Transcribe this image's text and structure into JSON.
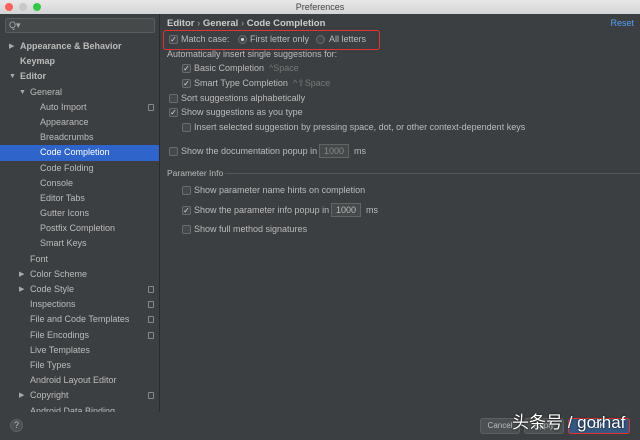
{
  "window": {
    "title": "Preferences"
  },
  "search": {
    "placeholder": "Q▾"
  },
  "sidebar": {
    "items": [
      {
        "label": "Appearance & Behavior",
        "level": 0,
        "arrow": "▶",
        "bold": true
      },
      {
        "label": "Keymap",
        "level": 0,
        "bold": true
      },
      {
        "label": "Editor",
        "level": 0,
        "arrow": "▼",
        "bold": true
      },
      {
        "label": "General",
        "level": 1,
        "arrow": "▼"
      },
      {
        "label": "Auto Import",
        "level": 2,
        "copy": true
      },
      {
        "label": "Appearance",
        "level": 2
      },
      {
        "label": "Breadcrumbs",
        "level": 2
      },
      {
        "label": "Code Completion",
        "level": 2,
        "selected": true
      },
      {
        "label": "Code Folding",
        "level": 2
      },
      {
        "label": "Console",
        "level": 2
      },
      {
        "label": "Editor Tabs",
        "level": 2
      },
      {
        "label": "Gutter Icons",
        "level": 2
      },
      {
        "label": "Postfix Completion",
        "level": 2
      },
      {
        "label": "Smart Keys",
        "level": 2
      },
      {
        "label": "Font",
        "level": 1
      },
      {
        "label": "Color Scheme",
        "level": 1,
        "arrow": "▶"
      },
      {
        "label": "Code Style",
        "level": 1,
        "arrow": "▶",
        "copy": true
      },
      {
        "label": "Inspections",
        "level": 1,
        "copy": true
      },
      {
        "label": "File and Code Templates",
        "level": 1,
        "copy": true
      },
      {
        "label": "File Encodings",
        "level": 1,
        "copy": true
      },
      {
        "label": "Live Templates",
        "level": 1
      },
      {
        "label": "File Types",
        "level": 1
      },
      {
        "label": "Android Layout Editor",
        "level": 1
      },
      {
        "label": "Copyright",
        "level": 1,
        "arrow": "▶",
        "copy": true
      },
      {
        "label": "Android Data Binding",
        "level": 1
      }
    ]
  },
  "breadcrumb": [
    "Editor",
    "General",
    "Code Completion"
  ],
  "reset": "Reset",
  "match_case": {
    "label": "Match case:",
    "checked": true,
    "first": "First letter only",
    "all": "All letters"
  },
  "auto_insert": {
    "label": "Automatically insert single suggestions for:",
    "basic": "Basic Completion",
    "basic_key": "^Space",
    "smart": "Smart Type Completion",
    "smart_key": "^⇧Space"
  },
  "sort": "Sort suggestions alphabetically",
  "show_typing": "Show suggestions as you type",
  "insert_selected": "Insert selected suggestion by pressing space, dot, or other context-dependent keys",
  "doc_popup": {
    "label": "Show the documentation popup in",
    "value": "1000",
    "unit": "ms"
  },
  "param_info": {
    "title": "Parameter Info",
    "hints": "Show parameter name hints on completion",
    "popup": "Show the parameter info popup in",
    "value": "1000",
    "unit": "ms",
    "full": "Show full method signatures"
  },
  "footer": {
    "help": "?",
    "cancel": "Cancel",
    "apply": "Apply",
    "ok": "OK"
  },
  "watermark": "头条号 / gorhaf"
}
